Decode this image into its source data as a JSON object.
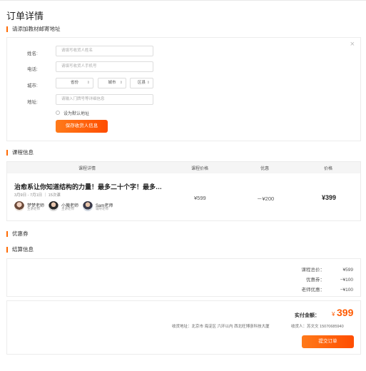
{
  "page_title": "订单详情",
  "address_section": {
    "title": "请添加教材邮寄地址",
    "name_label": "姓名:",
    "name_placeholder": "请填写收货人姓名",
    "phone_label": "电话:",
    "phone_placeholder": "请填写收货人手机号",
    "city_label": "城市:",
    "province": "省份",
    "city": "城市",
    "district": "区县",
    "address_label": "地址:",
    "address_placeholder": "请输入门牌号等详细信息",
    "default_label": "设为默认地址",
    "save_button": "保存收货人信息",
    "close_icon": "×"
  },
  "course_section": {
    "title": "课程信息",
    "columns": [
      "课程详情",
      "课程价格",
      "优惠",
      "价格"
    ],
    "course": {
      "title": "治愈系让你知道结构的力量！最多二十个字！最多…",
      "date": "3月9日 - 7月1日 ｜ 15次课",
      "price": "¥599",
      "discount": "－¥200",
      "final_price": "¥399",
      "teachers": [
        {
          "name": "梦梦老师",
          "role": "主讲老师"
        },
        {
          "name": "小薇老师",
          "role": "主讲老师"
        },
        {
          "name": "Sam老师",
          "role": "辅导老师"
        }
      ]
    }
  },
  "coupon_section": {
    "title": "优惠券"
  },
  "settlement_section": {
    "title": "结算信息",
    "rows": [
      {
        "label": "课程总价：",
        "value": "¥599"
      },
      {
        "label": "优惠券：",
        "value": "−¥100"
      },
      {
        "label": "老师优惠：",
        "value": "−¥100"
      }
    ],
    "pay_label": "实付金额：",
    "pay_currency": "¥",
    "pay_amount": "399",
    "address_line": "收货地址：北京市 海淀区 六环以内 西北旺博彦科技大厦",
    "receiver_line": "收货人：苏文文  15070685940",
    "submit_button": "提交订单"
  },
  "colors": {
    "accent": "#ff5a00"
  }
}
